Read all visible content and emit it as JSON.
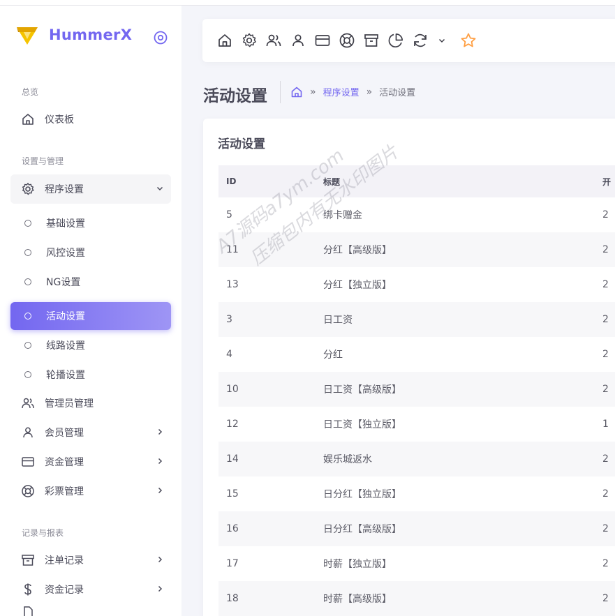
{
  "brand": {
    "name": "HummerX"
  },
  "sidebar": {
    "sections": {
      "overview": "总览",
      "settings": "设置与管理",
      "records": "记录与报表"
    },
    "dashboard": "仪表板",
    "program_settings": "程序设置",
    "sub_items": [
      "基础设置",
      "风控设置",
      "NG设置",
      "活动设置",
      "线路设置",
      "轮播设置"
    ],
    "admin_mgmt": "管理员管理",
    "member_mgmt": "会员管理",
    "fund_mgmt": "资金管理",
    "lottery_mgmt": "彩票管理",
    "bet_records": "注单记录",
    "fund_records": "资金记录"
  },
  "header": {
    "title": "活动设置",
    "breadcrumb": {
      "parent": "程序设置",
      "current": "活动设置"
    }
  },
  "card": {
    "title": "活动设置",
    "columns": {
      "id": "ID",
      "title": "标题",
      "next": "开"
    },
    "rows": [
      {
        "id": "5",
        "title": "绑卡赠金",
        "next": "2"
      },
      {
        "id": "11",
        "title": "分红【高级版】",
        "next": "2"
      },
      {
        "id": "13",
        "title": "分红【独立版】",
        "next": "2"
      },
      {
        "id": "3",
        "title": "日工资",
        "next": "2"
      },
      {
        "id": "4",
        "title": "分红",
        "next": "2"
      },
      {
        "id": "10",
        "title": "日工资【高级版】",
        "next": "2"
      },
      {
        "id": "12",
        "title": "日工资【独立版】",
        "next": "1"
      },
      {
        "id": "14",
        "title": "娱乐城返水",
        "next": "2"
      },
      {
        "id": "15",
        "title": "日分红【独立版】",
        "next": "2"
      },
      {
        "id": "16",
        "title": "日分红【高级版】",
        "next": "2"
      },
      {
        "id": "17",
        "title": "时薪【独立版】",
        "next": "2"
      },
      {
        "id": "18",
        "title": "时薪【高级版】",
        "next": "2"
      }
    ]
  },
  "watermark": {
    "line1": "A7源码a7ym.com",
    "line2": "压缩包内有无水印图片"
  },
  "colors": {
    "accent": "#7367f0",
    "star": "#ff9f43",
    "logo": "#f0b400"
  }
}
